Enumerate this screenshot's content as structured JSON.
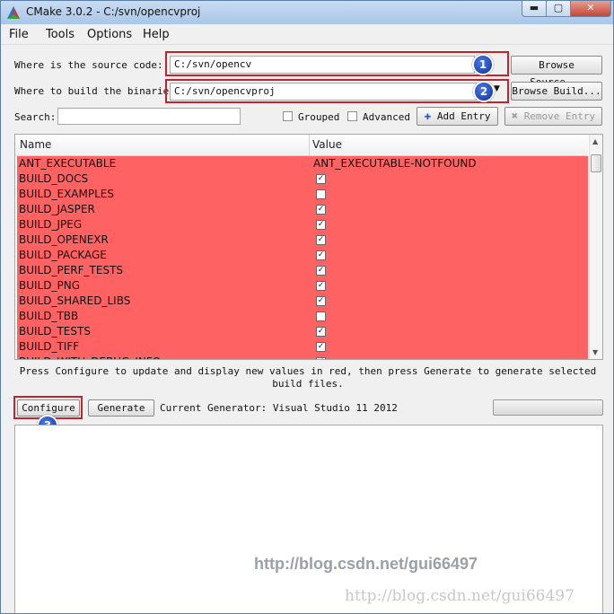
{
  "window": {
    "title": "CMake 3.0.2 - C:/svn/opencvproj",
    "controls": {
      "minimize": "▬",
      "maximize": "▢",
      "close": "✕"
    }
  },
  "menu": [
    "File",
    "Tools",
    "Options",
    "Help"
  ],
  "source": {
    "label": "Where is the source code:",
    "value": "C:/svn/opencv",
    "browse": "Browse Source..."
  },
  "build": {
    "label": "Where to build the binaries:",
    "value": "C:/svn/opencvproj",
    "browse": "Browse Build..."
  },
  "search": {
    "label": "Search:",
    "value": ""
  },
  "options": {
    "grouped": "Grouped",
    "advanced": "Advanced",
    "add_entry": "Add Entry",
    "remove_entry": "Remove Entry"
  },
  "table": {
    "headers": {
      "name": "Name",
      "value": "Value"
    },
    "row_color": "#ff6262",
    "rows": [
      {
        "name": "ANT_EXECUTABLE",
        "value": "ANT_EXECUTABLE-NOTFOUND"
      },
      {
        "name": "BUILD_DOCS",
        "checked": true
      },
      {
        "name": "BUILD_EXAMPLES",
        "checked": false
      },
      {
        "name": "BUILD_JASPER",
        "checked": true
      },
      {
        "name": "BUILD_JPEG",
        "checked": true
      },
      {
        "name": "BUILD_OPENEXR",
        "checked": true
      },
      {
        "name": "BUILD_PACKAGE",
        "checked": true
      },
      {
        "name": "BUILD_PERF_TESTS",
        "checked": true
      },
      {
        "name": "BUILD_PNG",
        "checked": true
      },
      {
        "name": "BUILD_SHARED_LIBS",
        "checked": true
      },
      {
        "name": "BUILD_TBB",
        "checked": false
      },
      {
        "name": "BUILD_TESTS",
        "checked": true
      },
      {
        "name": "BUILD_TIFF",
        "checked": true
      },
      {
        "name": "BUILD_WITH_DEBUG_INFO",
        "checked": true
      }
    ]
  },
  "hint": "Press Configure to update and display new values in red, then press Generate to generate selected build files.",
  "actions": {
    "configure": "Configure",
    "generate": "Generate",
    "generator": "Current Generator: Visual Studio 11 2012"
  },
  "progress": 0,
  "badges": [
    "1",
    "2",
    "3"
  ],
  "watermark": {
    "line1": "http://blog.csdn.net/gui66497",
    "line2": "http://blog.csdn.net/gui66497"
  }
}
